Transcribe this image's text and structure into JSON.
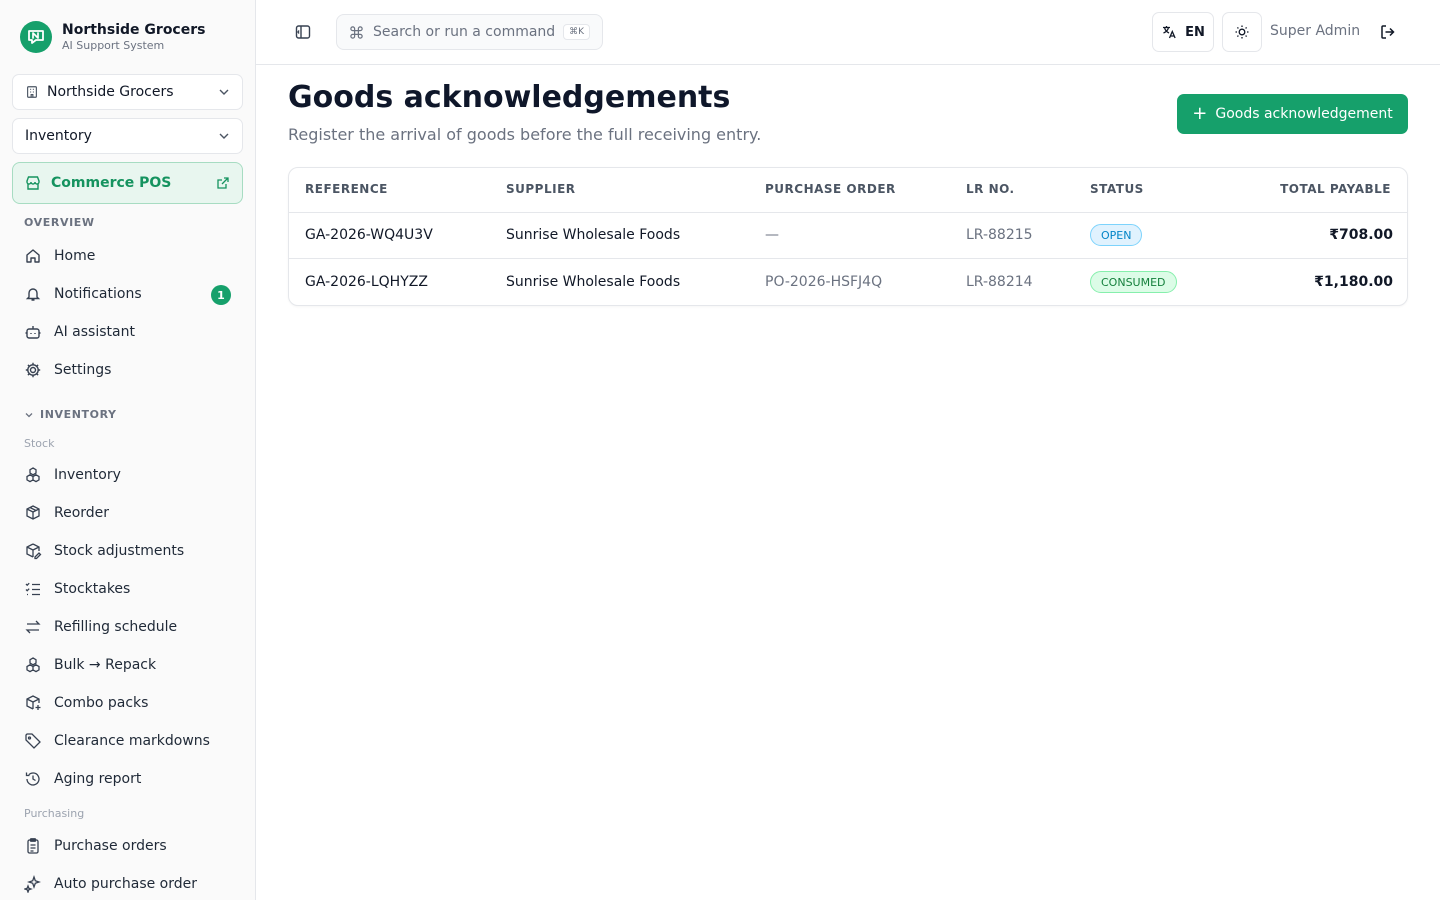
{
  "brand": {
    "name": "Northside Grocers",
    "subtitle": "AI Support System"
  },
  "sidebar": {
    "org_select": "Northside Grocers",
    "module_select": "Inventory",
    "pos_button": "Commerce POS",
    "overview_label": "OVERVIEW",
    "overview_items": [
      {
        "label": "Home",
        "icon": "home-icon"
      },
      {
        "label": "Notifications",
        "icon": "bell-icon",
        "badge": "1"
      },
      {
        "label": "AI assistant",
        "icon": "bot-icon"
      },
      {
        "label": "Settings",
        "icon": "gear-icon"
      }
    ],
    "inventory_label": "INVENTORY",
    "stock_label": "Stock",
    "stock_items": [
      {
        "label": "Inventory",
        "icon": "boxes-icon"
      },
      {
        "label": "Reorder",
        "icon": "package-icon"
      },
      {
        "label": "Stock adjustments",
        "icon": "package-edit-icon"
      },
      {
        "label": "Stocktakes",
        "icon": "list-check-icon"
      },
      {
        "label": "Refilling schedule",
        "icon": "arrows-exchange-icon"
      },
      {
        "label": "Bulk → Repack",
        "icon": "boxes-icon"
      },
      {
        "label": "Combo packs",
        "icon": "package-plus-icon"
      },
      {
        "label": "Clearance markdowns",
        "icon": "tag-icon"
      },
      {
        "label": "Aging report",
        "icon": "history-icon"
      }
    ],
    "purchasing_label": "Purchasing",
    "purchasing_items": [
      {
        "label": "Purchase orders",
        "icon": "clipboard-icon"
      },
      {
        "label": "Auto purchase order",
        "icon": "sparkles-icon"
      }
    ]
  },
  "topbar": {
    "search_placeholder": "Search or run a command",
    "search_shortcut": "⌘K",
    "language": "EN",
    "user": "Super Admin"
  },
  "page": {
    "title": "Goods acknowledgements",
    "subtitle": "Register the arrival of goods before the full receiving entry.",
    "add_button": "Goods acknowledgement"
  },
  "table": {
    "columns": [
      "REFERENCE",
      "SUPPLIER",
      "PURCHASE ORDER",
      "LR NO.",
      "STATUS",
      "TOTAL PAYABLE"
    ],
    "rows": [
      {
        "reference": "GA-2026-WQ4U3V",
        "supplier": "Sunrise Wholesale Foods",
        "purchase_order": "—",
        "lr_no": "LR-88215",
        "status": "OPEN",
        "total": "₹708.00"
      },
      {
        "reference": "GA-2026-LQHYZZ",
        "supplier": "Sunrise Wholesale Foods",
        "purchase_order": "PO-2026-HSFJ4Q",
        "lr_no": "LR-88214",
        "status": "CONSUMED",
        "total": "₹1,180.00"
      }
    ]
  },
  "colors": {
    "accent": "#16a06b",
    "open_status": "#0284c7",
    "consumed_status": "#15803d"
  }
}
